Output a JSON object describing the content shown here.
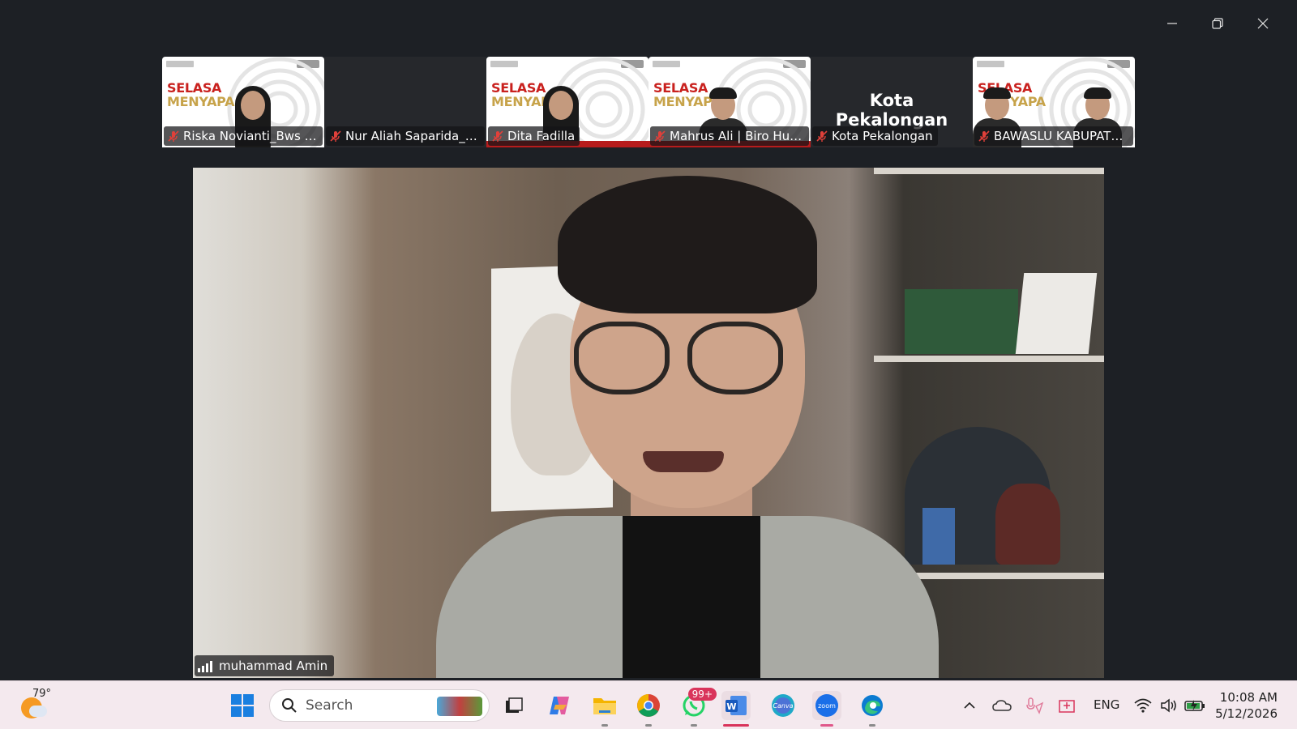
{
  "window": {
    "controls": [
      "minimize",
      "restore",
      "close"
    ]
  },
  "participants": [
    {
      "name": "Riska Novianti_Bws Te...",
      "tile": "banner",
      "banner_line1": "SELASA",
      "banner_line2": "MENYAPA",
      "muted": true
    },
    {
      "name": "Nur Aliah Saparida_ B...",
      "tile": "dark",
      "muted": true
    },
    {
      "name": "Dita Fadilla",
      "tile": "banner",
      "banner_line1": "SELASA",
      "banner_line2": "MENYAP",
      "muted": true
    },
    {
      "name": "Mahrus Ali | Biro Huku...",
      "tile": "banner",
      "banner_line1": "SELASA",
      "banner_line2": "MENYAP",
      "muted": true
    },
    {
      "name": "Kota Pekalongan",
      "tile": "name",
      "big_name": "Kota Pekalongan",
      "muted": true
    },
    {
      "name": "BAWASLU KABUPATEN...",
      "tile": "banner",
      "banner_line1": "SELASA",
      "banner_line2": "YAPA",
      "muted": true
    }
  ],
  "speaker": {
    "name": "muhammad Amin"
  },
  "taskbar": {
    "weather_temp": "79°",
    "search_placeholder": "Search",
    "whatsapp_badge": "99+",
    "language": "ENG",
    "time": "10:08 AM",
    "date": "5/12/2026",
    "apps": [
      "start-icon",
      "task-view-icon",
      "copilot-icon",
      "file-explorer-icon",
      "chrome-icon",
      "whatsapp-icon",
      "word-icon",
      "canva-icon",
      "zoom-icon",
      "edge-icon"
    ]
  },
  "colors": {
    "background": "#1d2025",
    "banner_red": "#c9211e",
    "banner_gold": "#c7a34a",
    "taskbar": "#f4e9ee",
    "muted_mic": "#e0403a"
  }
}
